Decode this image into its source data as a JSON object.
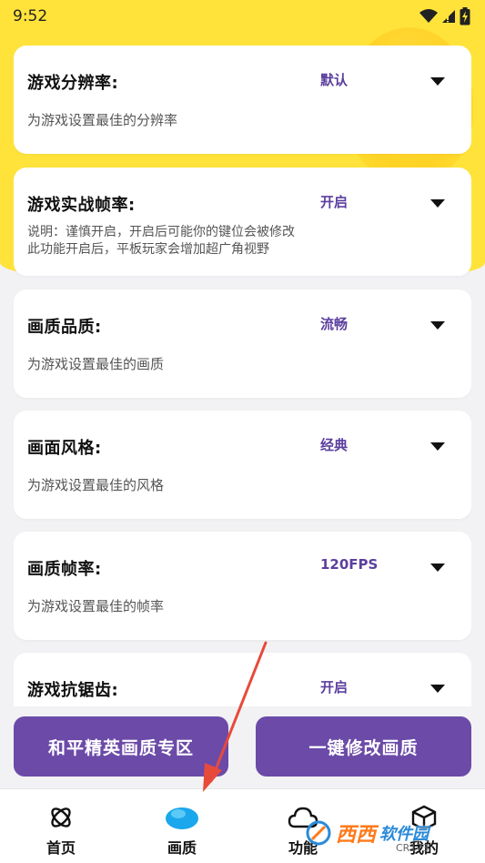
{
  "status_bar": {
    "time": "9:52"
  },
  "settings": [
    {
      "title": "游戏分辨率:",
      "value": "默认",
      "description": [
        "为游戏设置最佳的分辨率"
      ]
    },
    {
      "title": "游戏实战帧率:",
      "value": "开启",
      "description": [
        "说明：谨慎开启，开启后可能你的键位会被修改",
        "此功能开启后，平板玩家会增加超广角视野"
      ]
    },
    {
      "title": "画质品质:",
      "value": "流畅",
      "description": [
        "为游戏设置最佳的画质"
      ]
    },
    {
      "title": "画面风格:",
      "value": "经典",
      "description": [
        "为游戏设置最佳的风格"
      ]
    },
    {
      "title": "画质帧率:",
      "value": "120FPS",
      "description": [
        "为游戏设置最佳的帧率"
      ]
    },
    {
      "title": "游戏抗锯齿:",
      "value": "开启",
      "description": []
    }
  ],
  "actions": {
    "left_label": "和平精英画质专区",
    "right_label": "一键修改画质"
  },
  "tabs": [
    {
      "label": "首页",
      "icon": "atom-icon"
    },
    {
      "label": "画质",
      "icon": "cloud-blob-icon"
    },
    {
      "label": "功能",
      "icon": "cloud-icon"
    },
    {
      "label": "我的",
      "icon": "box-icon"
    }
  ],
  "watermark": {
    "brand": "西西",
    "text": "软件园",
    "sub": "CR173"
  },
  "colors": {
    "accent_yellow": "#ffe33a",
    "button_purple": "#6b4aa8",
    "value_purple": "#5b3f9e",
    "arrow_red": "#e84a3a"
  }
}
